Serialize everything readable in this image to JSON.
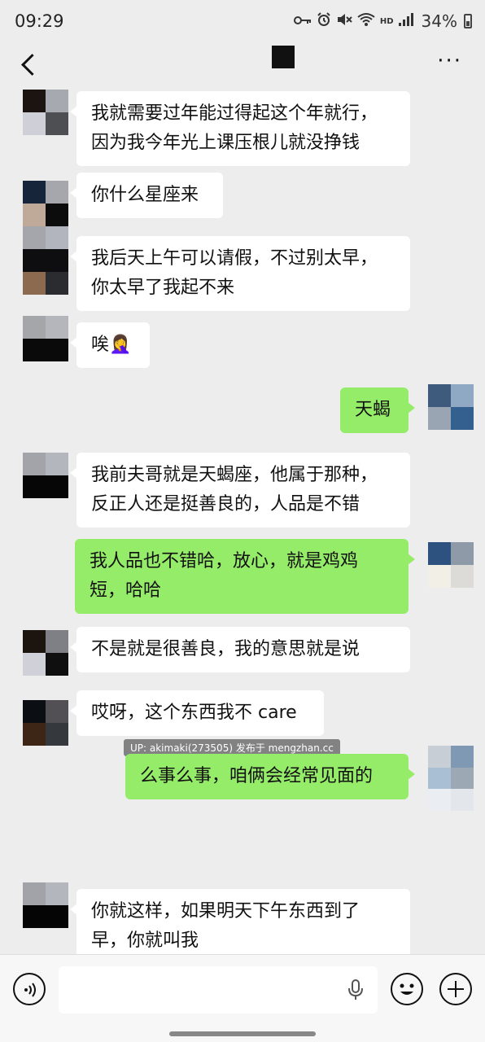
{
  "status": {
    "time": "09:29",
    "hd": "HD",
    "battery": "34%"
  },
  "header": {
    "back_icon": "chevron-left-icon",
    "more_icon": "more-icon",
    "more_label": "···"
  },
  "watermark": "UP: akimaki(273505) 发布于 mengzhan.cc",
  "messages": [
    {
      "side": "in",
      "line1": "我就需要过年能过得起这个年就行，",
      "line2": "因为我今年光上课压根儿就没挣钱"
    },
    {
      "side": "in",
      "line1": "你什么星座来"
    },
    {
      "side": "in",
      "line1": "我后天上午可以请假，不过别太早，",
      "line2": "你太早了我起不来"
    },
    {
      "side": "in",
      "line1": "唉🤦‍♀️"
    },
    {
      "side": "out",
      "line1": "天蝎"
    },
    {
      "side": "in",
      "line1": "我前夫哥就是天蝎座，他属于那种，",
      "line2": "反正人还是挺善良的，人品是不错"
    },
    {
      "side": "out",
      "line1": "我人品也不错哈，放心，就是鸡鸡",
      "line2": "短，哈哈"
    },
    {
      "side": "in",
      "line1": "不是就是很善良，我的意思就是说"
    },
    {
      "side": "in",
      "line1": "哎呀，这个东西我不 care"
    },
    {
      "side": "out",
      "line1": "么事么事，咱俩会经常见面的"
    },
    {
      "side": "in",
      "line1": "你就这样，如果明天下午东西到了",
      "line2": "早，你就叫我"
    }
  ],
  "toolbar": {
    "voice_icon": "voice-icon",
    "mic_icon": "mic-icon",
    "emoji_icon": "emoji-icon",
    "plus_icon": "plus-icon"
  }
}
